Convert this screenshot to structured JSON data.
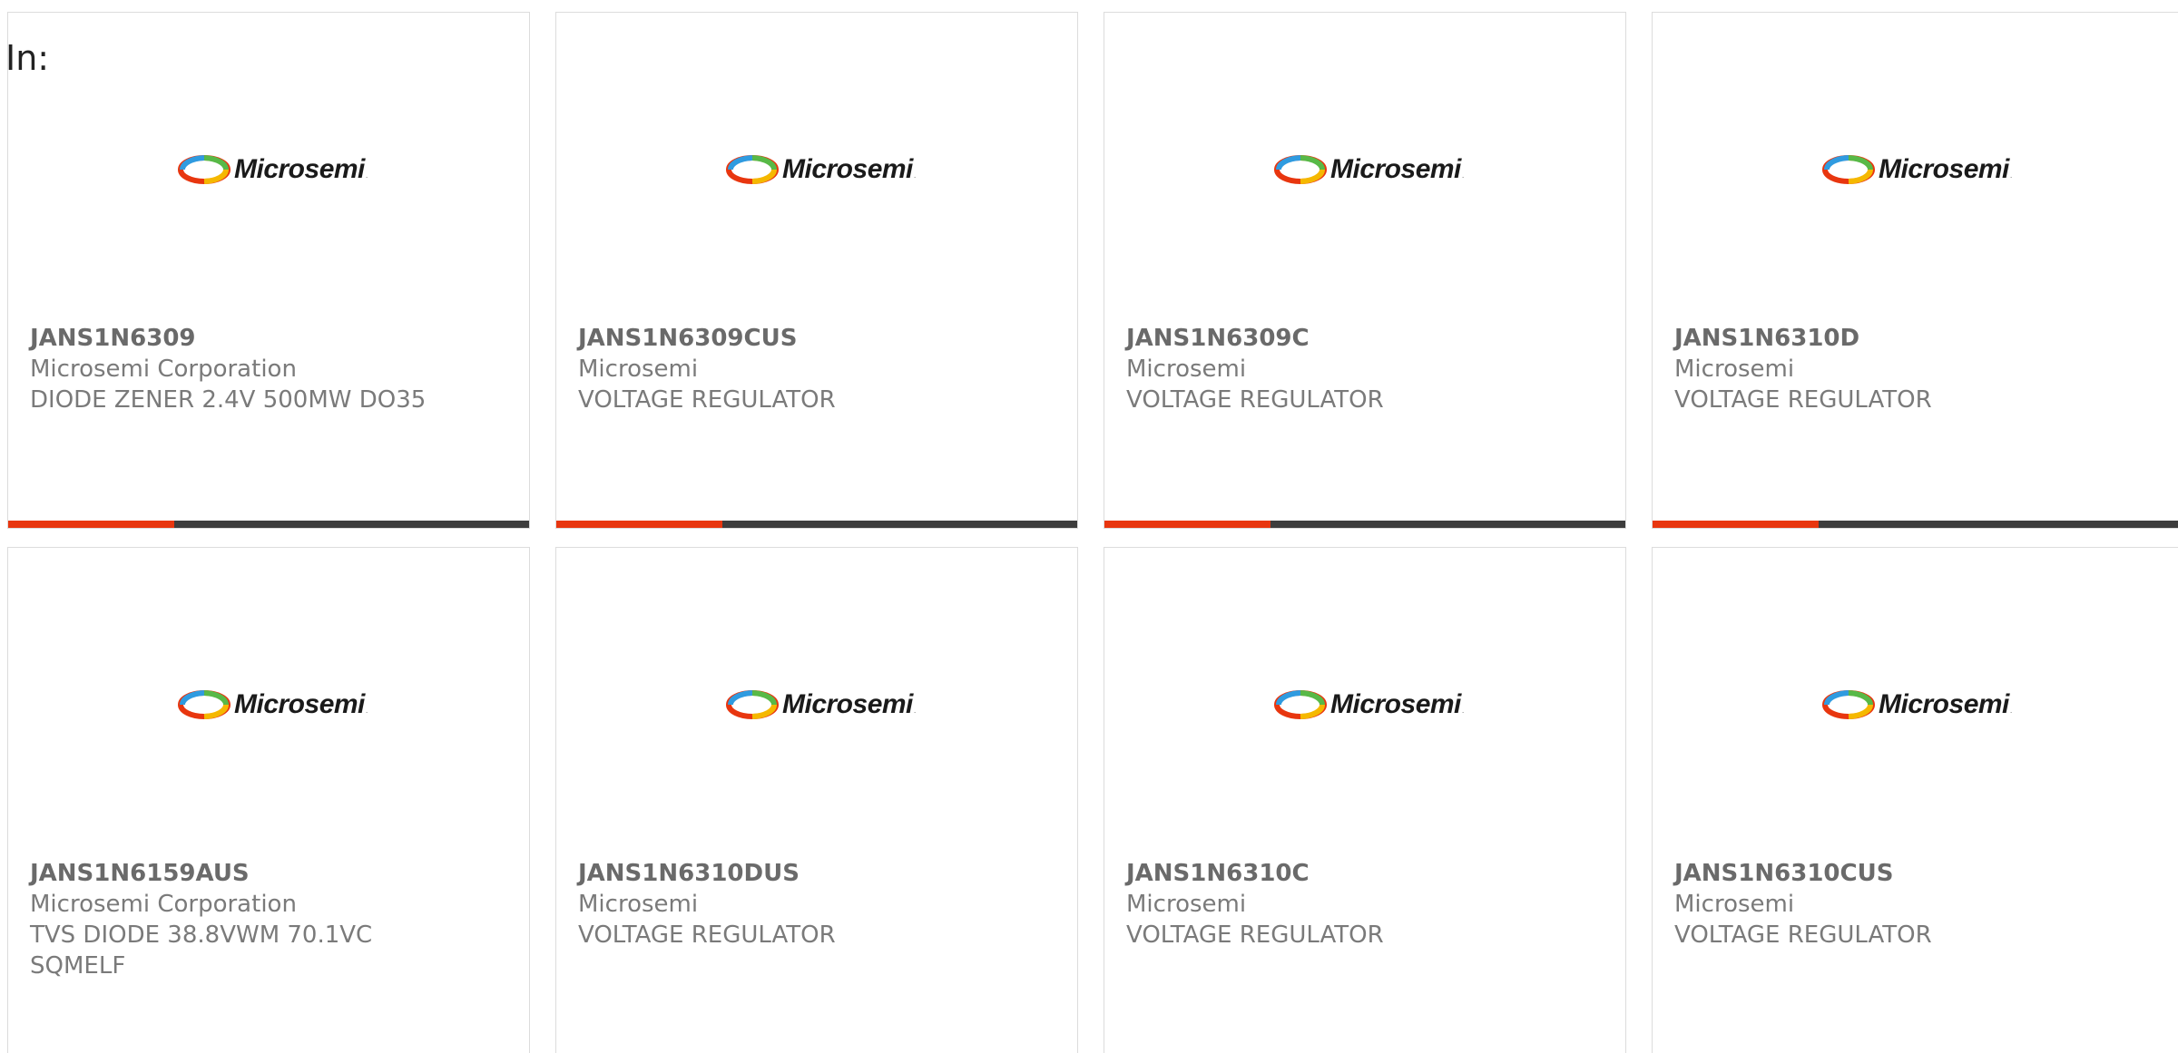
{
  "in_label": "In:",
  "colors": {
    "accent": "#e8360f",
    "bar_dark": "#3d3d3d",
    "card_border": "#dcdcdc",
    "text_muted": "#7a7a7a"
  },
  "logo": {
    "icon": "microsemi-logo-icon",
    "text": "Microsemi",
    "mark": "."
  },
  "cards": [
    {
      "part": "JANS1N6309",
      "manufacturer": "Microsemi Corporation",
      "desc1": "DIODE ZENER 2.4V 500MW DO35",
      "desc2": ""
    },
    {
      "part": "JANS1N6309CUS",
      "manufacturer": "Microsemi",
      "desc1": "VOLTAGE REGULATOR",
      "desc2": ""
    },
    {
      "part": "JANS1N6309C",
      "manufacturer": "Microsemi",
      "desc1": "VOLTAGE REGULATOR",
      "desc2": ""
    },
    {
      "part": "JANS1N6310D",
      "manufacturer": "Microsemi",
      "desc1": "VOLTAGE REGULATOR",
      "desc2": ""
    },
    {
      "part": "JANS1N6159AUS",
      "manufacturer": "Microsemi Corporation",
      "desc1": "TVS DIODE 38.8VWM 70.1VC",
      "desc2": "SQMELF"
    },
    {
      "part": "JANS1N6310DUS",
      "manufacturer": "Microsemi",
      "desc1": "VOLTAGE REGULATOR",
      "desc2": ""
    },
    {
      "part": "JANS1N6310C",
      "manufacturer": "Microsemi",
      "desc1": "VOLTAGE REGULATOR",
      "desc2": ""
    },
    {
      "part": "JANS1N6310CUS",
      "manufacturer": "Microsemi",
      "desc1": "VOLTAGE REGULATOR",
      "desc2": ""
    }
  ]
}
